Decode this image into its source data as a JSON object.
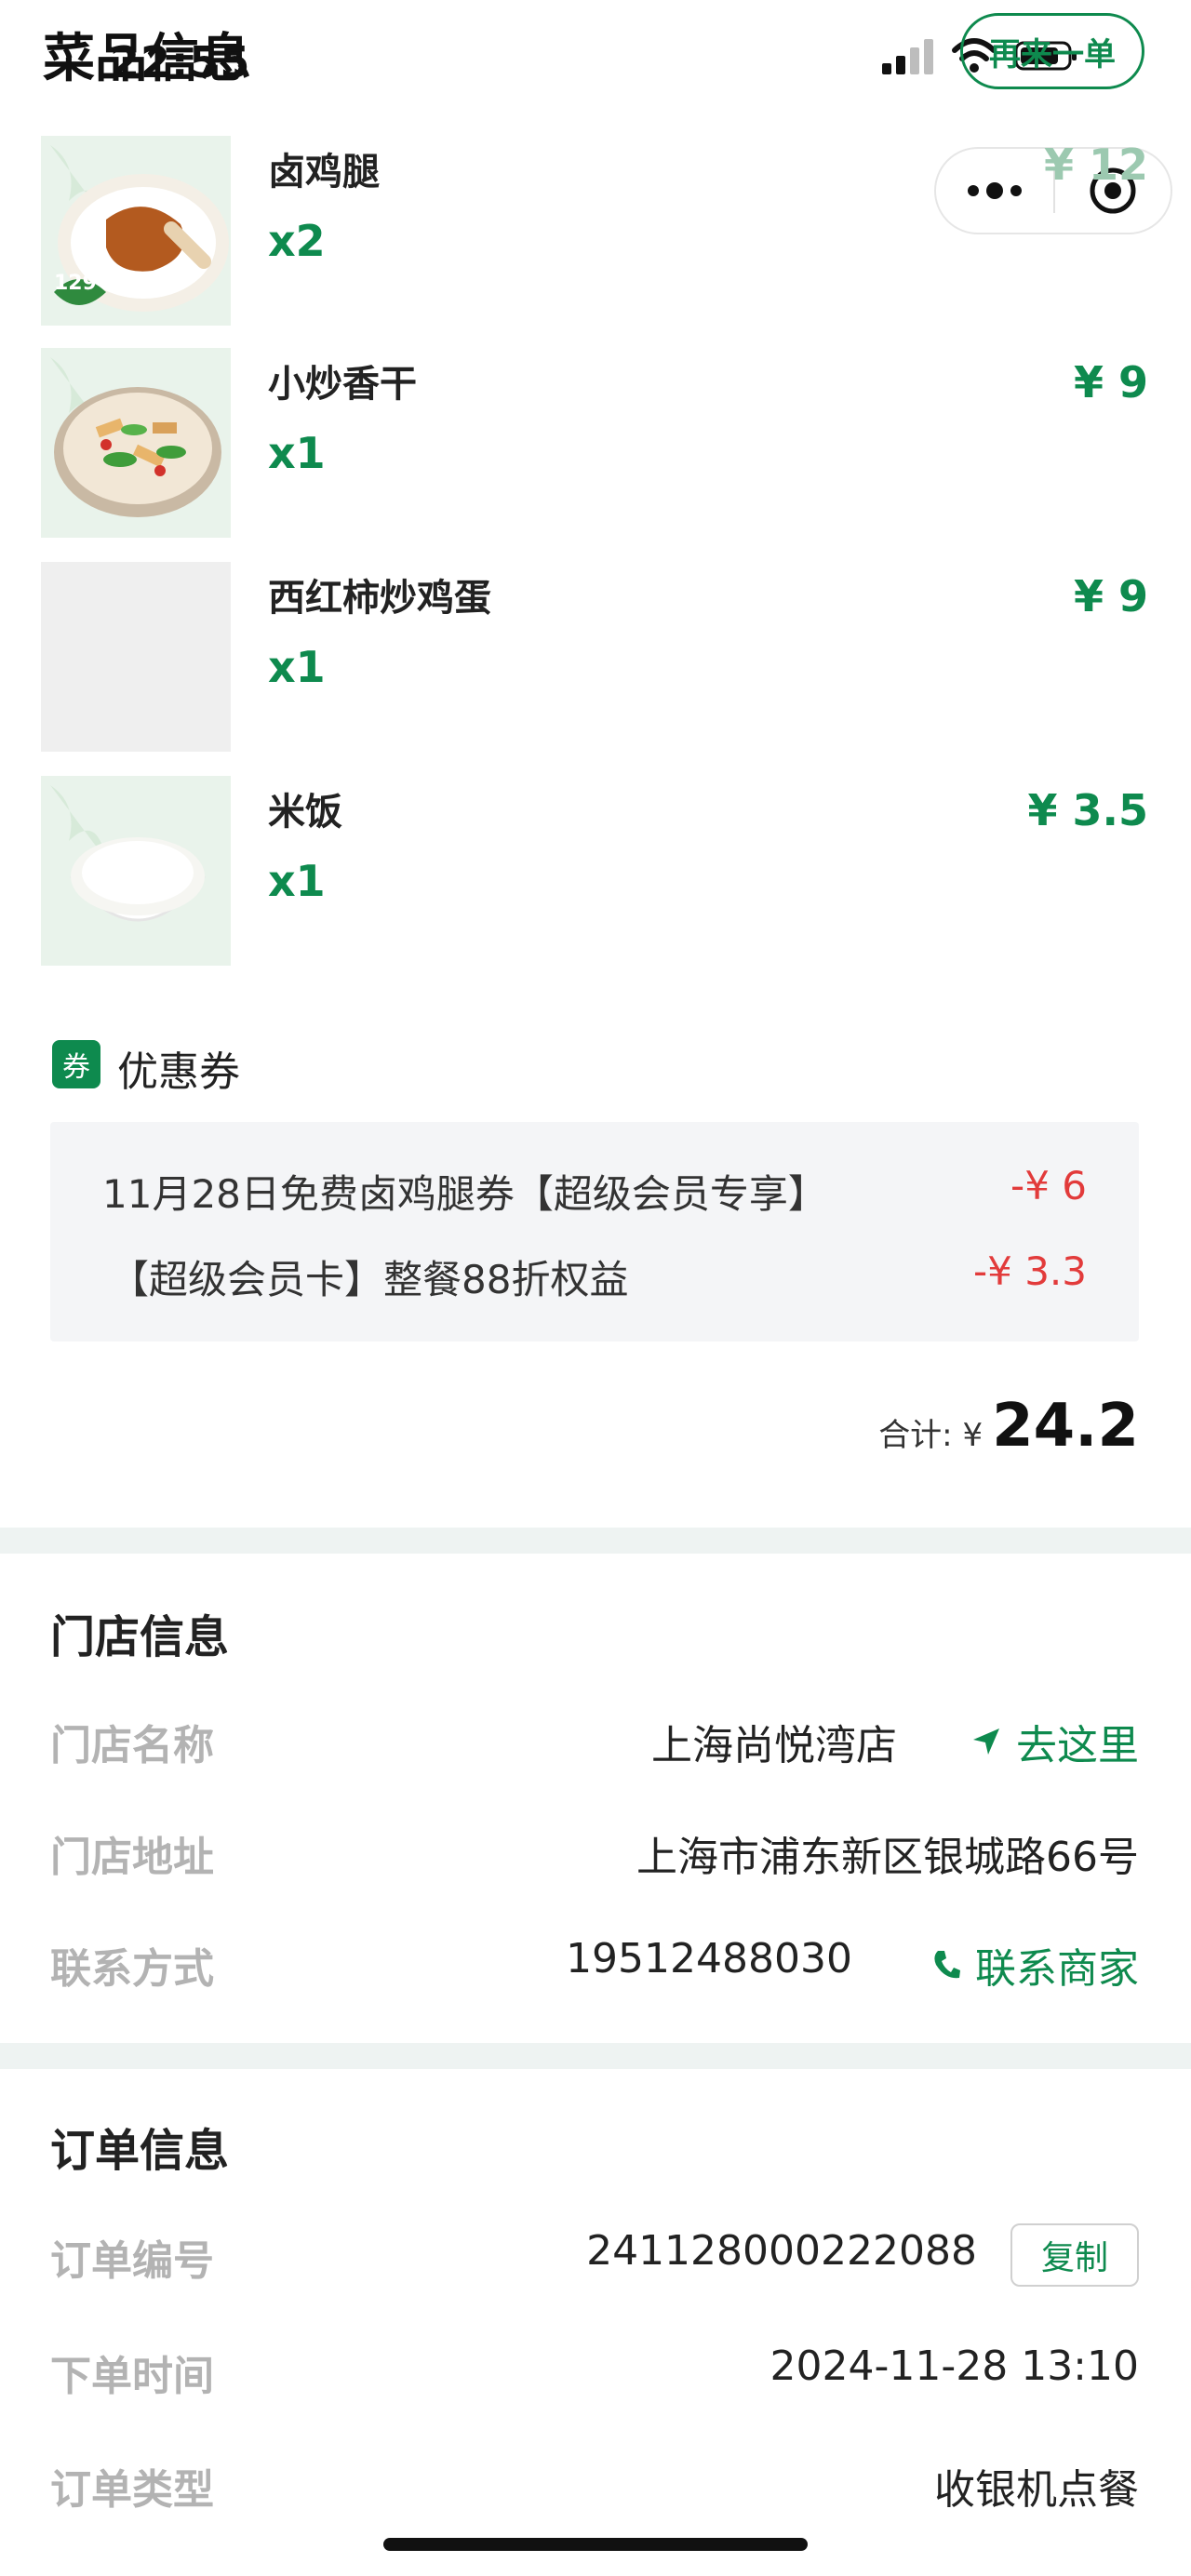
{
  "status_bar": {
    "time": "22:55"
  },
  "header": {
    "section_title": "菜品信息",
    "reorder_button": "再来一单"
  },
  "dishes": [
    {
      "name": "卤鸡腿",
      "qty": "x2",
      "price": "¥ 12",
      "image": "drumstick-photo",
      "badge": "129"
    },
    {
      "name": "小炒香干",
      "qty": "x1",
      "price": "¥ 9",
      "image": "stir-fry-photo"
    },
    {
      "name": "西红柿炒鸡蛋",
      "qty": "x1",
      "price": "¥ 9",
      "image": "placeholder"
    },
    {
      "name": "米饭",
      "qty": "x1",
      "price": "¥ 3.5",
      "image": "rice-photo"
    }
  ],
  "coupon": {
    "badge": "券",
    "title": "优惠券",
    "items": [
      {
        "label": "11月28日免费卤鸡腿券【超级会员专享】",
        "amount": "-¥ 6"
      },
      {
        "label": "【超级会员卡】整餐88折权益",
        "amount": "-¥ 3.3"
      }
    ],
    "total_label": "合计: ¥",
    "total_value": "24.2"
  },
  "store": {
    "title": "门店信息",
    "name_label": "门店名称",
    "name_value": "上海尚悦湾店",
    "navigate_link": "去这里",
    "address_label": "门店地址",
    "address_value": "上海市浦东新区银城路66号",
    "contact_label": "联系方式",
    "contact_value": "19512488030",
    "contact_link": "联系商家"
  },
  "order": {
    "title": "订单信息",
    "number_label": "订单编号",
    "number_value": "241128000222088",
    "copy_button": "复制",
    "time_label": "下单时间",
    "time_value": "2024-11-28 13:10",
    "type_label": "订单类型",
    "type_value": "收银机点餐"
  },
  "colors": {
    "brand_green": "#0e8a4e",
    "discount_red": "#e23b3b",
    "label_gray": "#b3b3b3"
  }
}
